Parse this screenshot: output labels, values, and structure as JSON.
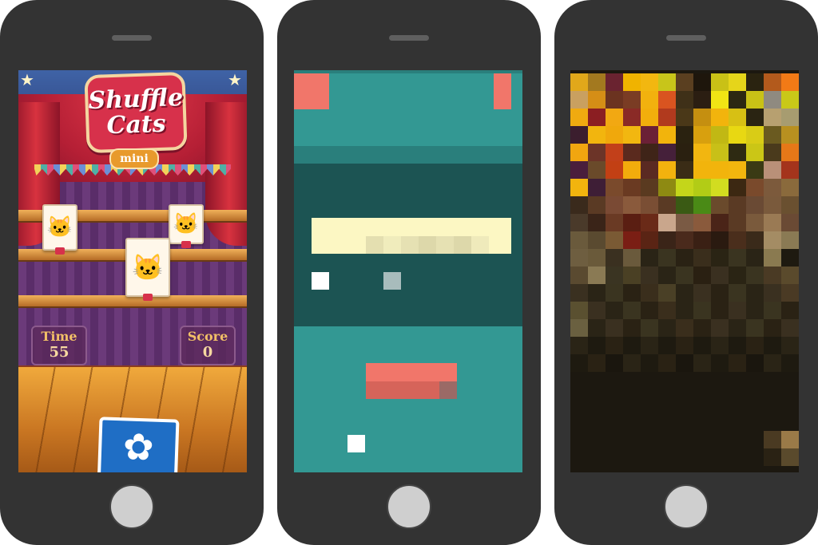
{
  "screens": [
    {
      "game": {
        "logo_line1": "Shuffle",
        "logo_line2": "Cats",
        "badge": "mini",
        "time_label": "Time",
        "time_value": "55",
        "score_label": "Score",
        "score_value": "0"
      }
    },
    {
      "description_hidden": ""
    },
    {
      "description_hidden": ""
    }
  ],
  "colors": {
    "phone_body": "#333333",
    "teal_bg": "#339893",
    "dark_teal": "#1c5453",
    "coral": "#f1766a",
    "cream": "#fcf7c3"
  }
}
